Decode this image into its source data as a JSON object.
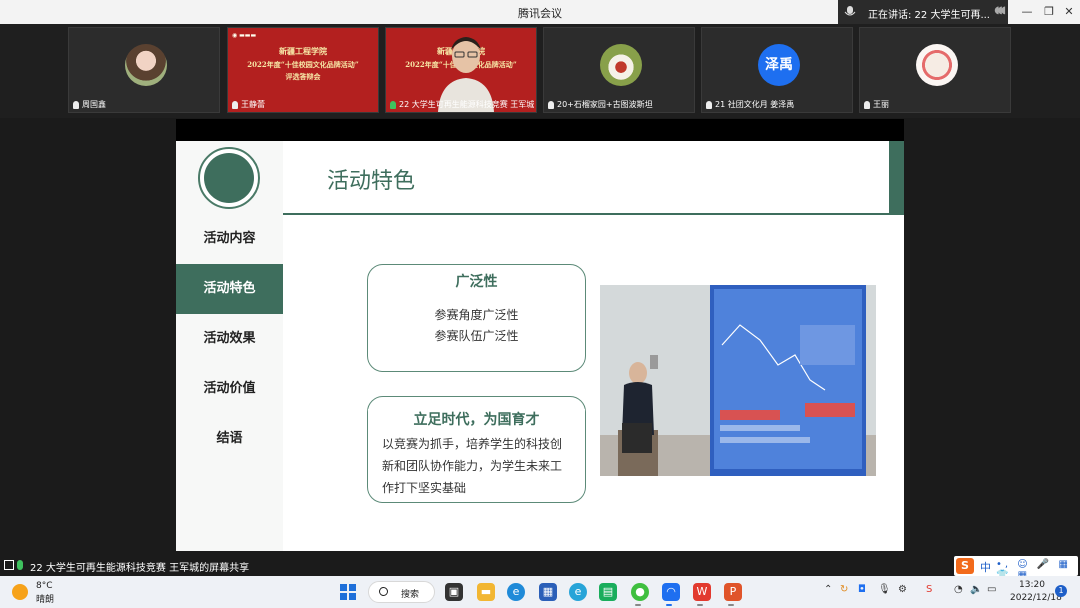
{
  "window": {
    "title": "腾讯会议",
    "speaking_label": "正在讲话: 22 大学生可再..."
  },
  "participants": [
    {
      "name": "周国鑫",
      "mic_on": false
    },
    {
      "name": "王静蕾",
      "mic_on": false,
      "poster": {
        "school": "新疆工程学院",
        "line1": "2022年度“十佳校园文化品牌活动”",
        "line2": "评选答辩会"
      }
    },
    {
      "name": "22 大学生可再生能源科技竞赛 王军城",
      "mic_on": true,
      "poster": {
        "school": "新疆工程学院",
        "line1": "2022年度“十佳校园文化品牌活动”"
      }
    },
    {
      "name": "20+石榴家园+古图波斯坦",
      "mic_on": false
    },
    {
      "name": "21 社团文化月 姜泽禹",
      "mic_on": false,
      "avatar_text": "泽禹"
    },
    {
      "name": "王丽",
      "mic_on": false
    }
  ],
  "slide": {
    "title": "活动特色",
    "menu": [
      {
        "label": "活动内容",
        "active": false
      },
      {
        "label": "活动特色",
        "active": true
      },
      {
        "label": "活动效果",
        "active": false
      },
      {
        "label": "活动价值",
        "active": false
      },
      {
        "label": "结语",
        "active": false
      }
    ],
    "card1": {
      "title": "广泛性",
      "line1": "参赛角度广泛性",
      "line2": "参赛队伍广泛性"
    },
    "card2": {
      "title": "立足时代，为国育才",
      "body": "以竞赛为抓手，培养学生的科技创新和团队协作能力，为学生未来工作打下坚实基础"
    },
    "accent_color": "#3e6e5d"
  },
  "share_bar": {
    "text": "22 大学生可再生能源科技竞赛 王军城的屏幕共享"
  },
  "ime": {
    "logo": "S",
    "lang": "中"
  },
  "taskbar": {
    "weather": {
      "temp": "8°C",
      "desc": "晴朗"
    },
    "search_label": "搜索",
    "time": "13:20",
    "date": "2022/12/18",
    "notification_count": "1"
  }
}
